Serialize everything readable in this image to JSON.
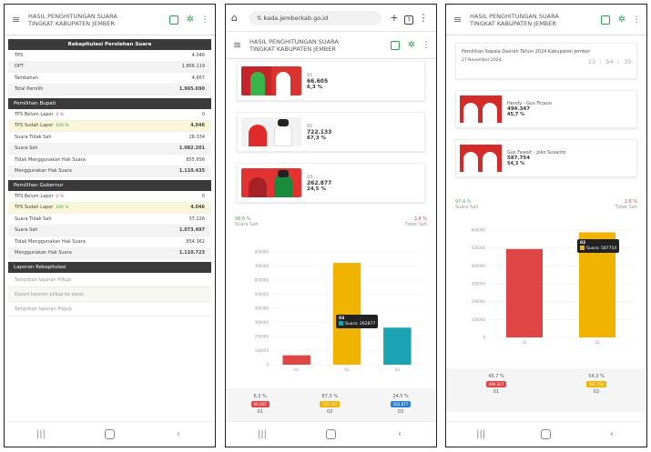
{
  "phone1": {
    "header": {
      "title_line1": "HASIL PENGHITUNGAN SUARA",
      "title_line2": "TINGKAT KABUPATEN JEMBER"
    },
    "rekap": {
      "title": "Rekapitulasi Perolehan Suara",
      "rows": [
        {
          "label": "TPS",
          "value": "4.046"
        },
        {
          "label": "DPT",
          "value": "1.866.119"
        },
        {
          "label": "Tambahan",
          "value": "4.667"
        },
        {
          "label": "Total Pemilih",
          "value": "1.965.690"
        }
      ]
    },
    "bupati": {
      "title": "Pemilihan Bupati",
      "rows": [
        {
          "label": "TPS Belum Lapor",
          "sub": "0 %",
          "value": "0"
        },
        {
          "label": "TPS Sudah Lapor",
          "sub": "100 %",
          "value": "4.046"
        },
        {
          "label": "Suara Tidak Sah",
          "value": "28.334"
        },
        {
          "label": "Suara Sah",
          "value": "1.082.201"
        },
        {
          "label": "Tidak Menggunakan Hak Suara",
          "value": "855.656"
        },
        {
          "label": "Menggunakan Hak Suara",
          "value": "1.110.435"
        }
      ]
    },
    "gubernur": {
      "title": "Pemilihan Gubernur",
      "rows": [
        {
          "label": "TPS Belum Lapor",
          "sub": "0 %",
          "value": "0"
        },
        {
          "label": "TPS Sudah Lapor",
          "sub": "100 %",
          "value": "4.046"
        },
        {
          "label": "Suara Tidak Sah",
          "value": "37.226"
        },
        {
          "label": "Suara Sah",
          "value": "1.073.497"
        },
        {
          "label": "Tidak Menggunakan Hak Suara",
          "value": "854.362"
        },
        {
          "label": "Menggunakan Hak Suara",
          "value": "1.110.723"
        }
      ]
    },
    "laporan": {
      "title": "Laporan Rekapitulasi",
      "items": [
        "Tampilkan laporan Pilkup",
        "Export laporan pilkup ke excel",
        "Tampilkan laporan Pilgub"
      ]
    }
  },
  "phone2": {
    "url": "kada.jemberkab.go.id",
    "tab_count": "3",
    "header": {
      "title_line1": "HASIL PENGHITUNGAN SUARA",
      "title_line2": "TINGKAT KABUPATEN JEMBER"
    },
    "candidates": [
      {
        "num": "01",
        "votes": "66.605",
        "pct": "6,3 %"
      },
      {
        "num": "02",
        "votes": "722.133",
        "pct": "67,3 %"
      },
      {
        "num": "03",
        "votes": "262.877",
        "pct": "24,5 %"
      }
    ],
    "sah_pct": "96,6 %",
    "tidak_sah_pct": "3,4 %",
    "sah_label": "Suara Sah",
    "tidak_sah_label": "Tidak Sah",
    "tooltip": {
      "title": "03",
      "text": "Suara: 262877"
    },
    "footer": [
      {
        "pct": "6,3 %",
        "badge": "66.605",
        "num": "01",
        "color": "#e04545"
      },
      {
        "pct": "67,3 %",
        "badge": "722.133",
        "num": "02",
        "color": "#f0b400"
      },
      {
        "pct": "24,5 %",
        "badge": "262.877",
        "num": "03",
        "color": "#2a7fd0"
      }
    ]
  },
  "phone3": {
    "header": {
      "title_line1": "HASIL PENGHITUNGAN SUARA",
      "title_line2": "TINGKAT KABUPATEN JEMBER"
    },
    "election": {
      "title": "Pemilihan Kepala Daerah Tahun 2024 Kabupaten Jember",
      "date": "27 November 2024",
      "clock": "23 : 54 : 39"
    },
    "candidates": [
      {
        "name": "Hendy - Gus Firjaun",
        "votes": "494.347",
        "pct": "45,7 %"
      },
      {
        "name": "Gus Fawait - Joko Susanto",
        "votes": "587.754",
        "pct": "54,3 %"
      }
    ],
    "sah_pct": "97,4 %",
    "tidak_sah_pct": "2,6 %",
    "sah_label": "Suara Sah",
    "tidak_sah_label": "Tidak Sah",
    "tooltip": {
      "title": "02",
      "text": "Suara: 587754"
    },
    "footer": [
      {
        "pct": "45,7 %",
        "badge": "494.347",
        "num": "01",
        "color": "#e04545"
      },
      {
        "pct": "54,3 %",
        "badge": "587.754",
        "num": "02",
        "color": "#f0b400"
      }
    ]
  },
  "chart_data": [
    {
      "type": "bar",
      "categories": [
        "01",
        "02",
        "03"
      ],
      "values": [
        66605,
        722133,
        262877
      ],
      "colors": [
        "#e04545",
        "#f0b400",
        "#1aa3b0"
      ],
      "yticks": [
        "0",
        "100000",
        "200000",
        "300000",
        "400000",
        "500000",
        "600000",
        "700000",
        "800000"
      ],
      "ylim": [
        0,
        800000
      ]
    },
    {
      "type": "bar",
      "categories": [
        "01",
        "02"
      ],
      "values": [
        494347,
        587754
      ],
      "colors": [
        "#e04545",
        "#f0b400"
      ],
      "yticks": [
        "0",
        "100000",
        "200000",
        "300000",
        "400000",
        "500000",
        "600000"
      ],
      "ylim": [
        0,
        600000
      ]
    }
  ]
}
